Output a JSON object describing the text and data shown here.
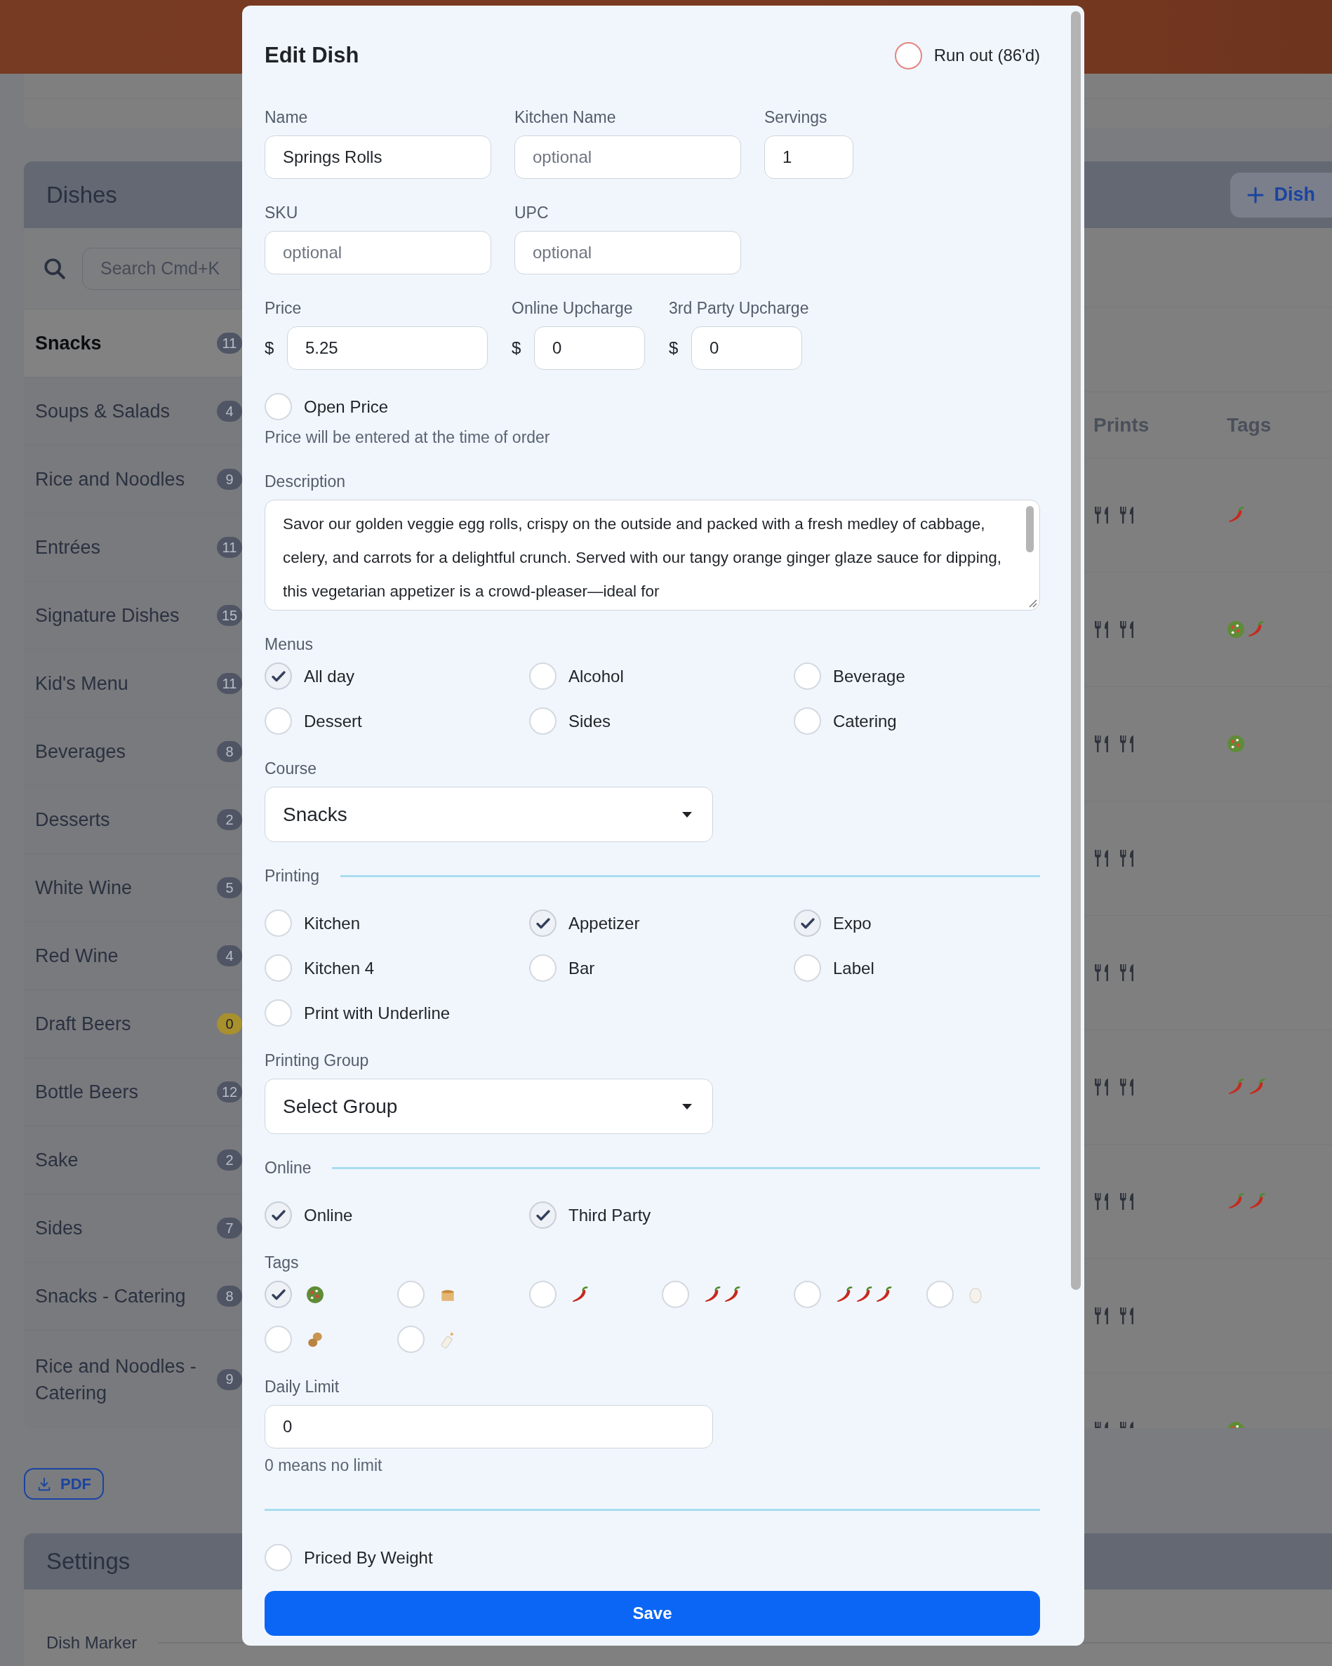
{
  "dishes_panel": {
    "title": "Dishes",
    "add_button": "Dish",
    "search": {
      "placeholder": "Search Cmd+K"
    },
    "categories": [
      {
        "name": "Snacks",
        "count": "11",
        "selected": true,
        "color": "#4f5564"
      },
      {
        "name": "Soups & Salads",
        "count": "4",
        "selected": false,
        "color": "#4f5564"
      },
      {
        "name": "Rice and Noodles",
        "count": "9",
        "selected": false,
        "color": "#4f5564"
      },
      {
        "name": "Entrées",
        "count": "11",
        "selected": false,
        "color": "#4f5564"
      },
      {
        "name": "Signature Dishes",
        "count": "15",
        "selected": false,
        "color": "#4f5564"
      },
      {
        "name": "Kid's Menu",
        "count": "11",
        "selected": false,
        "color": "#4f5564"
      },
      {
        "name": "Beverages",
        "count": "8",
        "selected": false,
        "color": "#4f5564"
      },
      {
        "name": "Desserts",
        "count": "2",
        "selected": false,
        "color": "#4f5564"
      },
      {
        "name": "White Wine",
        "count": "5",
        "selected": false,
        "color": "#4f5564"
      },
      {
        "name": "Red Wine",
        "count": "4",
        "selected": false,
        "color": "#4f5564"
      },
      {
        "name": "Draft Beers",
        "count": "0",
        "selected": false,
        "color": "#a8902e"
      },
      {
        "name": "Bottle Beers",
        "count": "12",
        "selected": false,
        "color": "#4f5564"
      },
      {
        "name": "Sake",
        "count": "2",
        "selected": false,
        "color": "#4f5564"
      },
      {
        "name": "Sides",
        "count": "7",
        "selected": false,
        "color": "#4f5564"
      },
      {
        "name": "Snacks - Catering",
        "count": "8",
        "selected": false,
        "color": "#4f5564"
      },
      {
        "name": "Rice and Noodles - Catering",
        "count": "9",
        "selected": false,
        "color": "#4f5564"
      }
    ],
    "table": {
      "columns": [
        "Prints",
        "Tags"
      ],
      "rows": [
        {
          "tags": [
            {
              "kind": "chili"
            }
          ]
        },
        {
          "tags": [
            {
              "kind": "salad"
            },
            {
              "kind": "chili"
            }
          ]
        },
        {
          "tags": [
            {
              "kind": "salad"
            }
          ]
        },
        {},
        {},
        {
          "tags": [
            {
              "kind": "double-chili"
            }
          ]
        },
        {
          "tags": [
            {
              "kind": "double-chili"
            }
          ]
        },
        {},
        {
          "tags": [
            {
              "kind": "salad"
            }
          ]
        }
      ]
    }
  },
  "pdf_button": "PDF",
  "settings_panel": {
    "title": "Settings",
    "rows": [
      "Dish Marker"
    ]
  },
  "edit_dish": {
    "title": "Edit Dish",
    "run_out": {
      "label": "Run out (86'd)",
      "checked": false
    },
    "field_rows": [
      [
        {
          "label": "Name",
          "value": "Springs Rolls"
        },
        {
          "label": "Kitchen Name",
          "placeholder": "optional"
        },
        {
          "label": "Servings",
          "value": "1"
        }
      ],
      [
        {
          "label": "SKU",
          "placeholder": "optional"
        },
        {
          "label": "UPC",
          "placeholder": "optional"
        }
      ],
      [
        {
          "label": "Price",
          "prefix": "$",
          "value": "5.25"
        },
        {
          "label": "Online Upcharge",
          "prefix": "$",
          "value": "0"
        },
        {
          "label": "3rd Party Upcharge",
          "prefix": "$",
          "value": "0"
        }
      ]
    ],
    "open_price": {
      "label": "Open Price",
      "checked": false,
      "hint": "Price will be entered at the time of order"
    },
    "description": {
      "label": "Description",
      "value": "Savor our golden veggie egg rolls, crispy on the outside and packed with a fresh medley of cabbage, celery, and carrots for a delightful crunch. Served with our tangy orange ginger glaze sauce for dipping, this vegetarian appetizer is a crowd-pleaser—ideal for"
    },
    "menus": {
      "label": "Menus",
      "options": [
        {
          "label": "All day",
          "checked": true
        },
        {
          "label": "Alcohol",
          "checked": false
        },
        {
          "label": "Beverage",
          "checked": false
        },
        {
          "label": "Dessert",
          "checked": false
        },
        {
          "label": "Sides",
          "checked": false
        },
        {
          "label": "Catering",
          "checked": false
        }
      ]
    },
    "course": {
      "label": "Course",
      "value": "Snacks"
    },
    "printing": {
      "label": "Printing",
      "options": [
        {
          "label": "Kitchen",
          "checked": false
        },
        {
          "label": "Appetizer",
          "checked": true
        },
        {
          "label": "Expo",
          "checked": true
        },
        {
          "label": "Kitchen 4",
          "checked": false
        },
        {
          "label": "Bar",
          "checked": false
        },
        {
          "label": "Label",
          "checked": false
        },
        {
          "label": "Print with Underline",
          "checked": false
        }
      ]
    },
    "printing_group": {
      "label": "Printing Group",
      "value": "Select Group"
    },
    "online": {
      "label": "Online",
      "options": [
        {
          "label": "Online",
          "checked": true
        },
        {
          "label": "Third Party",
          "checked": true
        }
      ]
    },
    "tags": {
      "label": "Tags",
      "options": [
        {
          "kind": "salad",
          "checked": true
        },
        {
          "kind": "bread",
          "checked": false
        },
        {
          "kind": "chili",
          "checked": false
        },
        {
          "kind": "double-chili",
          "checked": false
        },
        {
          "kind": "triple-chili",
          "checked": false
        },
        {
          "kind": "egg",
          "checked": false
        },
        {
          "kind": "peanut",
          "checked": false
        },
        {
          "kind": "bottle",
          "checked": false
        }
      ]
    },
    "daily_limit": {
      "label": "Daily Limit",
      "value": "0",
      "hint": "0 means no limit"
    },
    "priced_by_weight": {
      "label": "Priced By Weight",
      "checked": false
    },
    "save_button": "Save"
  }
}
